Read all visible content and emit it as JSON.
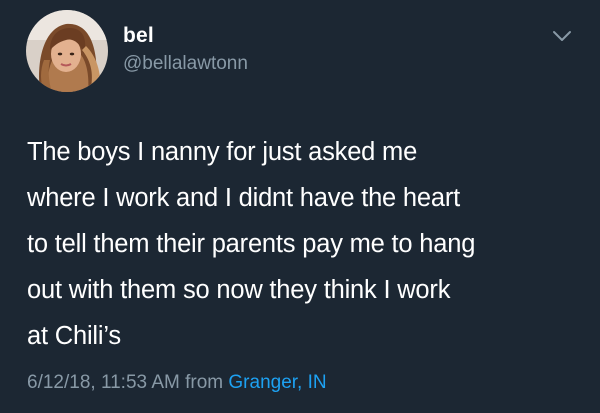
{
  "user": {
    "display_name": "bel",
    "handle": "@bellalawtonn",
    "avatar_icon": "profile-photo"
  },
  "tweet": {
    "lines": [
      "The boys I nanny for just asked me",
      "where I work and I didnt have the heart",
      "to tell them their parents pay me to hang",
      "out with them so now they think I work",
      "at Chili’s"
    ],
    "timestamp": "6/12/18, 11:53 AM",
    "from_label": "from",
    "location": "Granger, IN"
  },
  "menu": {
    "icon": "chevron-down-icon"
  },
  "colors": {
    "background": "#1c2733",
    "text": "#ffffff",
    "secondary": "#8899a6",
    "link": "#1da1f2"
  }
}
